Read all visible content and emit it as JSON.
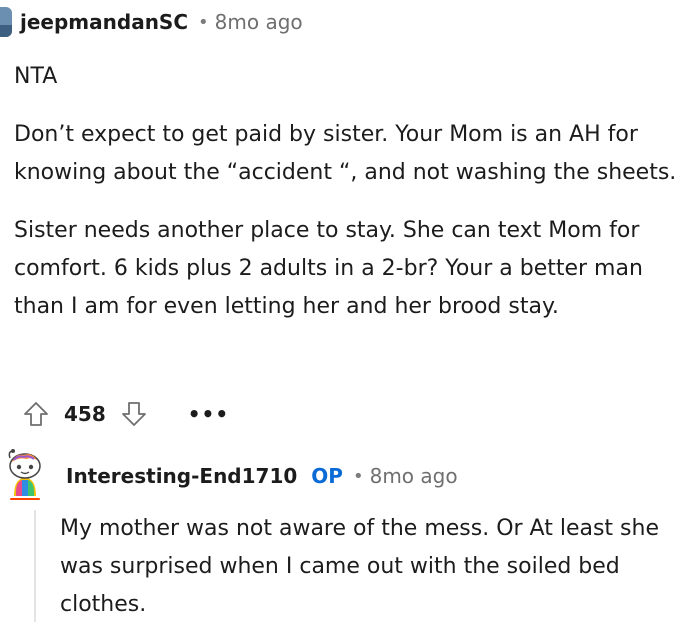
{
  "comment1": {
    "username": "jeepmandanSC",
    "separator": "•",
    "time": "8mo ago",
    "paragraphs": [
      "NTA",
      "Don’t expect to get paid by sister. Your Mom is an AH for knowing about the “accident “, and not washing the sheets.",
      "Sister needs another place to stay. She can text Mom for comfort. 6 kids plus 2 adults in a 2-br? Your a better man than I am for even letting her and her brood stay."
    ],
    "score": "458",
    "more_label": "•••"
  },
  "comment2": {
    "username": "Interesting-End1710",
    "badge": "OP",
    "separator": "•",
    "time": "8mo ago",
    "paragraphs": [
      "My mother was not aware of the mess. Or At least she was surprised when I came out with the soiled bed clothes."
    ]
  },
  "colors": {
    "text": "#1c1c1c",
    "muted": "#6f6f6f",
    "op_blue": "#0a6ad6",
    "thread_line": "#e4e4e4"
  }
}
